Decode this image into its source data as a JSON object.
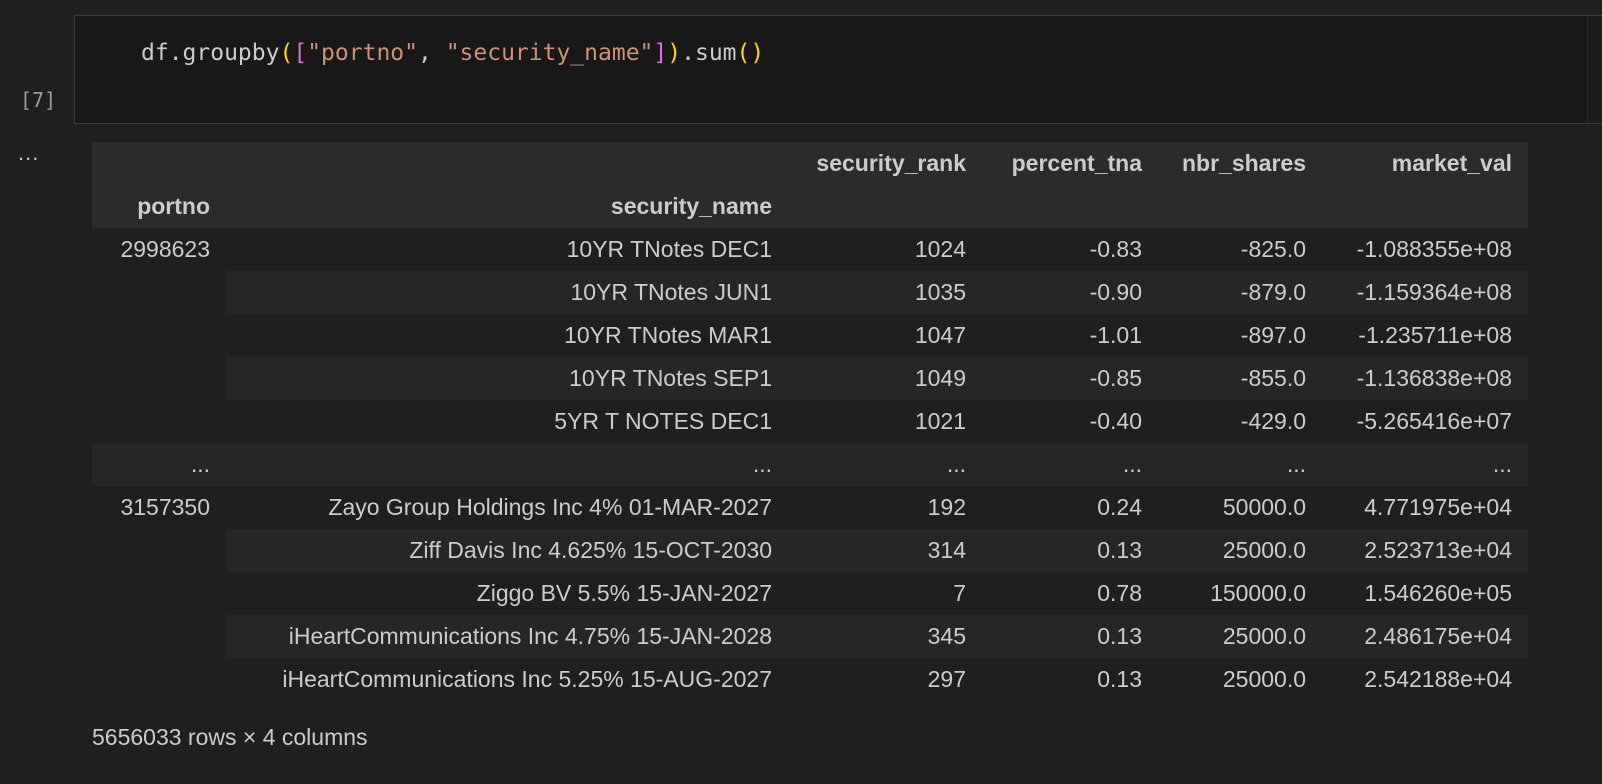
{
  "cell": {
    "execution_count": "[7]",
    "code_tokens": {
      "prefix": "df.groupby",
      "open_paren": "(",
      "open_bracket": "[",
      "str1": "\"portno\"",
      "comma": ", ",
      "str2": "\"security_name\"",
      "close_bracket": "]",
      "close_paren": ")",
      "method": ".sum",
      "call": "()"
    }
  },
  "output": {
    "menu_glyph": "...",
    "columns": [
      "security_rank",
      "percent_tna",
      "nbr_shares",
      "market_val"
    ],
    "index_names": [
      "portno",
      "security_name"
    ],
    "rows": [
      {
        "portno": "2998623",
        "name": "10YR TNotes DEC1",
        "rank": "1024",
        "pct": "-0.83",
        "shares": "-825.0",
        "mval": "-1.088355e+08"
      },
      {
        "portno": "",
        "name": "10YR TNotes JUN1",
        "rank": "1035",
        "pct": "-0.90",
        "shares": "-879.0",
        "mval": "-1.159364e+08"
      },
      {
        "portno": "",
        "name": "10YR TNotes MAR1",
        "rank": "1047",
        "pct": "-1.01",
        "shares": "-897.0",
        "mval": "-1.235711e+08"
      },
      {
        "portno": "",
        "name": "10YR TNotes SEP1",
        "rank": "1049",
        "pct": "-0.85",
        "shares": "-855.0",
        "mval": "-1.136838e+08"
      },
      {
        "portno": "",
        "name": "5YR T NOTES DEC1",
        "rank": "1021",
        "pct": "-0.40",
        "shares": "-429.0",
        "mval": "-5.265416e+07"
      },
      {
        "portno": "...",
        "name": "...",
        "rank": "...",
        "pct": "...",
        "shares": "...",
        "mval": "..."
      },
      {
        "portno": "3157350",
        "name": "Zayo Group Holdings Inc 4% 01-MAR-2027",
        "rank": "192",
        "pct": "0.24",
        "shares": "50000.0",
        "mval": "4.771975e+04"
      },
      {
        "portno": "",
        "name": "Ziff Davis Inc 4.625% 15-OCT-2030",
        "rank": "314",
        "pct": "0.13",
        "shares": "25000.0",
        "mval": "2.523713e+04"
      },
      {
        "portno": "",
        "name": "Ziggo BV 5.5% 15-JAN-2027",
        "rank": "7",
        "pct": "0.78",
        "shares": "150000.0",
        "mval": "1.546260e+05"
      },
      {
        "portno": "",
        "name": "iHeartCommunications Inc 4.75% 15-JAN-2028",
        "rank": "345",
        "pct": "0.13",
        "shares": "25000.0",
        "mval": "2.486175e+04"
      },
      {
        "portno": "",
        "name": "iHeartCommunications Inc 5.25% 15-AUG-2027",
        "rank": "297",
        "pct": "0.13",
        "shares": "25000.0",
        "mval": "2.542188e+04"
      }
    ],
    "footer": "5656033 rows × 4 columns"
  }
}
